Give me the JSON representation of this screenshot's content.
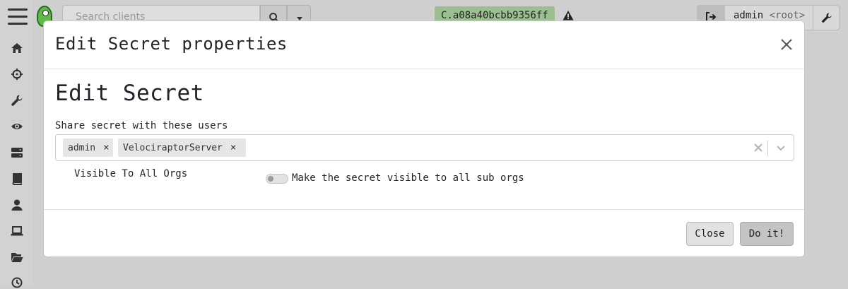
{
  "app": {
    "search": {
      "placeholder": "Search clients"
    },
    "client_id": "C.a08a40bcbb9356ff",
    "user": {
      "name": "admin",
      "org": "<root>"
    },
    "sidebar_icons": [
      "home-icon",
      "crosshair-icon",
      "wrench-icon",
      "eye-icon",
      "server-icon",
      "book-icon",
      "user-icon",
      "laptop-icon",
      "folder-open-icon",
      "history-icon"
    ]
  },
  "modal": {
    "title": "Edit Secret properties",
    "section_title": "Edit Secret",
    "share_label": "Share secret with these users",
    "selected_users": [
      {
        "label": "admin",
        "remove": "×"
      },
      {
        "label": "VelociraptorServer",
        "remove": "×"
      }
    ],
    "visible_label": "Visible To All Orgs",
    "visible_toggle": {
      "on": false,
      "description": "Make the secret visible to all sub orgs"
    },
    "buttons": {
      "close": "Close",
      "submit": "Do it!"
    }
  }
}
